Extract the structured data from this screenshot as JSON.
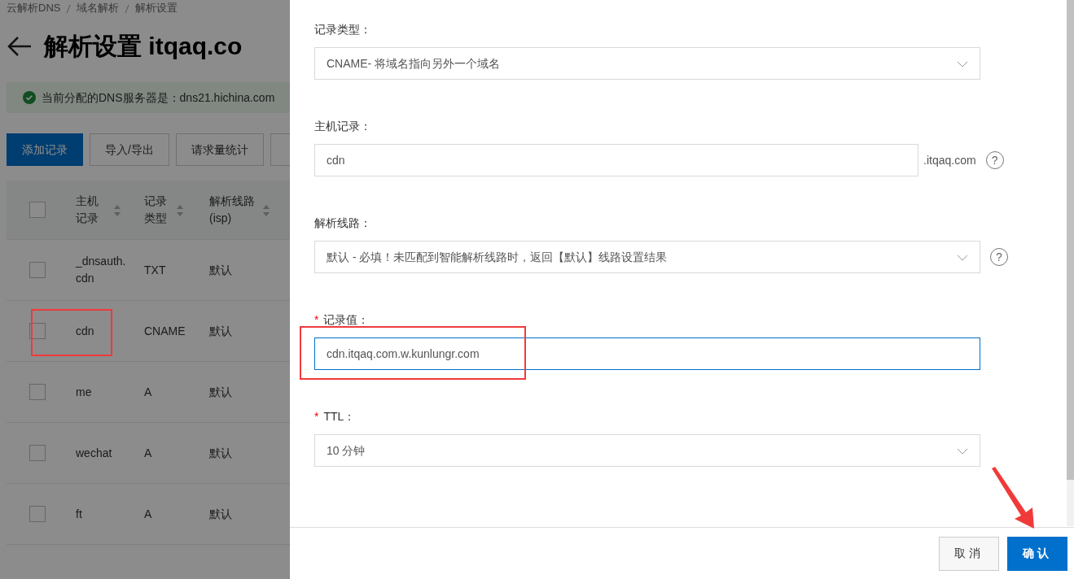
{
  "breadcrumb": [
    "云解析DNS",
    "域名解析",
    "解析设置"
  ],
  "page_title": "解析设置 itqaq.co",
  "alert": {
    "text": "当前分配的DNS服务器是：dns21.hichina.com"
  },
  "toolbar": [
    {
      "label": "添加记录",
      "primary": true
    },
    {
      "label": "导入/导出",
      "primary": false
    },
    {
      "label": "请求量统计",
      "primary": false
    }
  ],
  "table": {
    "select_all_checked": false,
    "columns": [
      "主机记录",
      "记录类型",
      "解析线路(isp)"
    ],
    "rows": [
      {
        "host": "_dnsauth.cdn",
        "type": "TXT",
        "line": "默认",
        "checked": false,
        "highlighted": false
      },
      {
        "host": "cdn",
        "type": "CNAME",
        "line": "默认",
        "checked": false,
        "highlighted": true
      },
      {
        "host": "me",
        "type": "A",
        "line": "默认",
        "checked": false,
        "highlighted": false
      },
      {
        "host": "wechat",
        "type": "A",
        "line": "默认",
        "checked": false,
        "highlighted": false
      },
      {
        "host": "ft",
        "type": "A",
        "line": "默认",
        "checked": false,
        "highlighted": false
      }
    ]
  },
  "drawer": {
    "fields": [
      {
        "label": "记录类型：",
        "kind": "select",
        "value": "CNAME- 将域名指向另外一个域名"
      },
      {
        "label": "主机记录：",
        "kind": "input",
        "value": "cdn",
        "suffix": ".itqaq.com",
        "help": "?"
      },
      {
        "label": "解析线路：",
        "kind": "select",
        "value": "默认 - 必填！未匹配到智能解析线路时，返回【默认】线路设置结果",
        "help": "?"
      },
      {
        "label": "记录值：",
        "mark": "*",
        "kind": "input",
        "value": "cdn.itqaq.com.w.kunlungr.com",
        "focused": true,
        "highlighted": true
      },
      {
        "label": "TTL：",
        "mark": "*",
        "kind": "select",
        "value": "10 分钟"
      }
    ],
    "buttons": [
      {
        "label": "取消",
        "primary": false
      },
      {
        "label": "确认",
        "primary": true
      }
    ]
  }
}
